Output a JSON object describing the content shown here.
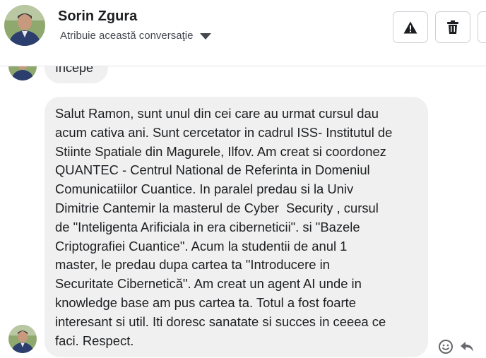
{
  "header": {
    "contact_name": "Sorin Zgura",
    "assign_label": "Atribuie această conversaţie",
    "avatar_icon": "profile-photo-avatar"
  },
  "actions": {
    "report_icon": "warning-icon",
    "delete_icon": "trash-icon"
  },
  "previous_message": {
    "text": "începe"
  },
  "message": {
    "lines": [
      "Salut Ramon, sunt unul din cei care au urmat cursul dau",
      "acum cativa ani. Sunt cercetator in cadrul ISS- Institutul de",
      "Stiinte Spatiale din Magurele, Ilfov. Am creat si coordonez",
      "QUANTEC - Centrul National de Referinta in Domeniul",
      "Comunicatiilor Cuantice. In paralel predau si la Univ",
      "Dimitrie Cantemir la masterul de Cyber  Security , cursul",
      "de \"Inteligenta Arificiala in era ciberneticii\". si \"Bazele",
      "Criptografiei Cuantice\". Acum la studentii de anul 1",
      "master, le predau dupa cartea ta \"Introducere in",
      "Securitate Cibernetică\". Am creat un agent AI unde in",
      "knowledge base am pus cartea ta. Totul a fost foarte",
      "interesant si util. Iti doresc sanatate si succes in ceeea ce",
      "faci. Respect."
    ]
  },
  "colors": {
    "bubble": "#f0f0f0",
    "text": "#1c1e21",
    "icon": "#65676b",
    "border": "#ccd0d5"
  }
}
